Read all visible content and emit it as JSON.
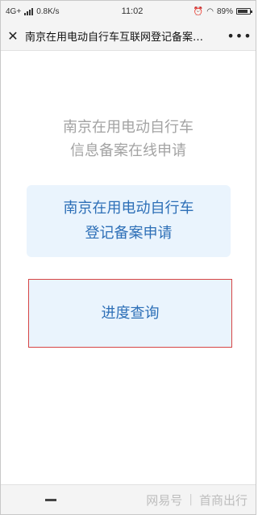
{
  "status_bar": {
    "network": "4G+",
    "speed": "0.8K/s",
    "time": "11:02",
    "battery": "89%",
    "battery_level": 0.89
  },
  "nav": {
    "close_icon": "close-icon",
    "title": "南京在用电动自行车互联网登记备案…",
    "more_icon": "more-icon"
  },
  "heading": {
    "line1": "南京在用电动自行车",
    "line2": "信息备案在线申请"
  },
  "apply_card": {
    "line1": "南京在用电动自行车",
    "line2": "登记备案申请"
  },
  "progress_card": {
    "label": "进度查询"
  },
  "bottom": {
    "menu_icon": "menu-icon",
    "watermark_left": "网易号",
    "watermark_sep": "|",
    "watermark_right": "首商出行"
  },
  "colors": {
    "accent": "#2d6fb7",
    "card_bg": "#eaf4fd",
    "heading_gray": "#a3a3a3",
    "highlight_border": "#d64545"
  }
}
